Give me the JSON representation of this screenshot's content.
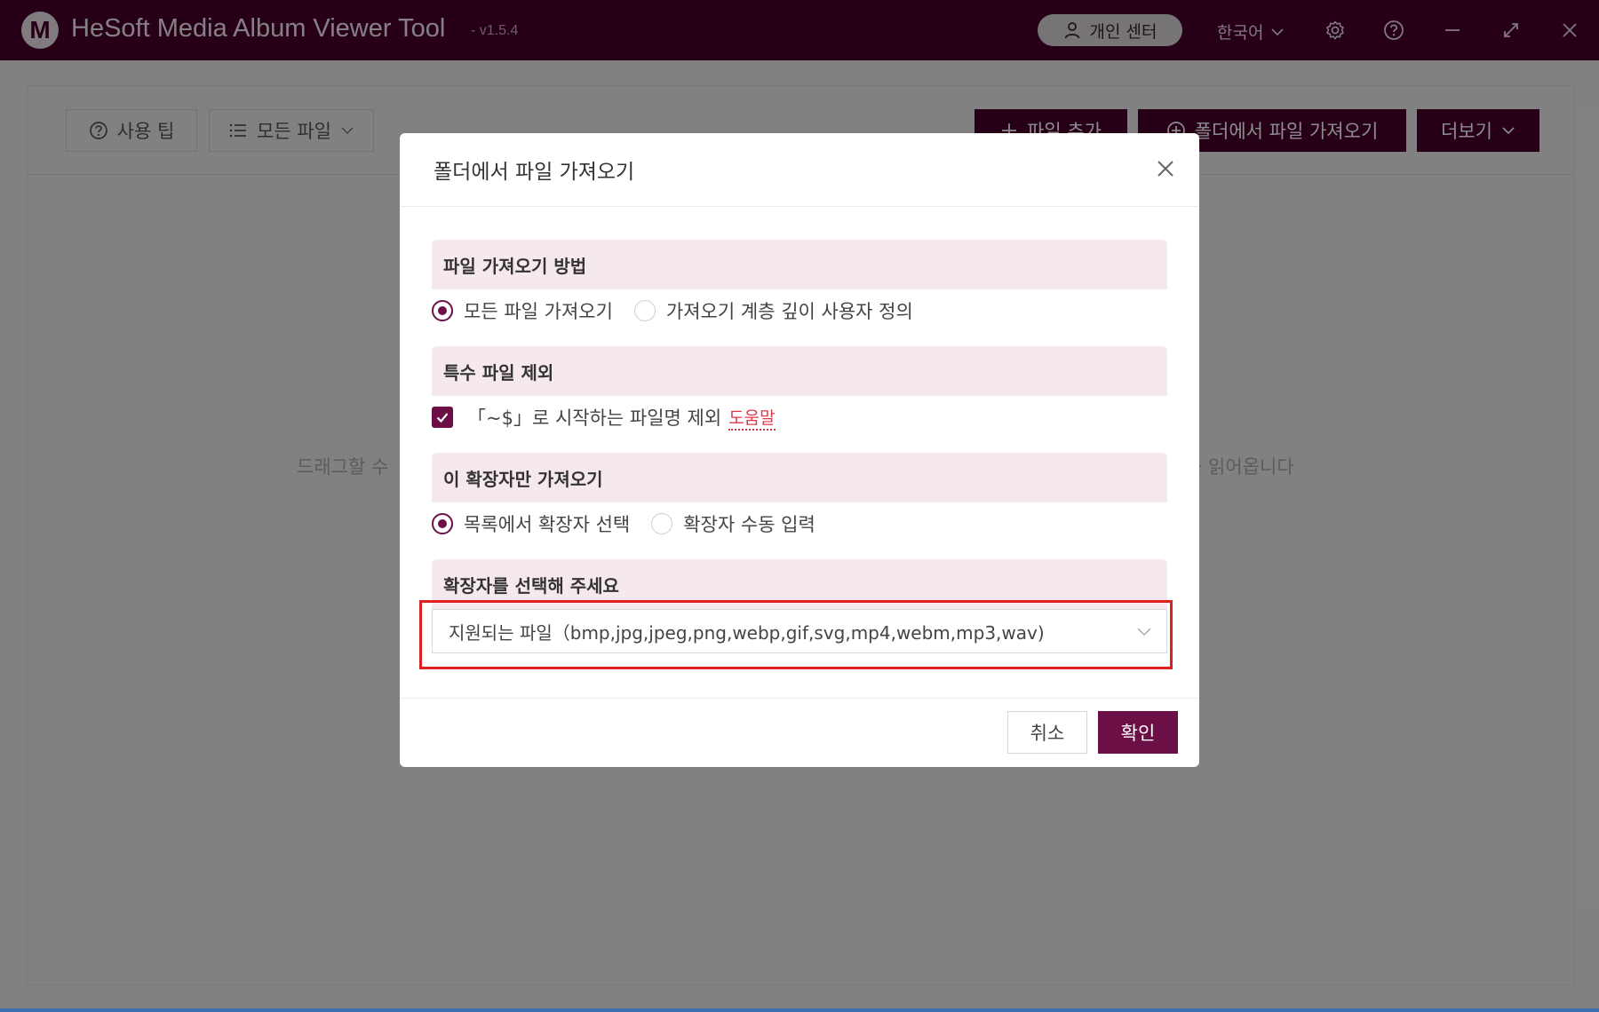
{
  "app": {
    "logo_letter": "M",
    "title": "HeSoft Media Album Viewer Tool",
    "version": "- v1.5.4",
    "user_center": "개인 센터",
    "language": "한국어"
  },
  "toolbar": {
    "tips_label": "사용 팁",
    "filter_label": "모든 파일",
    "add_file_label": "파일 추가",
    "import_folder_label": "폴더에서 파일 가져오기",
    "more_label": "더보기"
  },
  "drop_hint": {
    "left": "드래그할 수",
    "right": "를 읽어옵니다"
  },
  "dialog": {
    "title": "폴더에서 파일 가져오기",
    "section_method": "파일 가져오기 방법",
    "method_all": "모든 파일 가져오기",
    "method_custom": "가져오기 계층 깊이 사용자 정의",
    "section_exclude": "특수 파일 제외",
    "exclude_text": "「~$」로 시작하는 파일명 제외",
    "help_link": "도움말",
    "section_ext": "이 확장자만 가져오기",
    "ext_from_list": "목록에서 확장자 선택",
    "ext_manual": "확장자 수동 입력",
    "section_select": "확장자를 선택해 주세요",
    "select_value": "지원되는 파일（bmp,jpg,jpeg,png,webp,gif,svg,mp4,webm,mp3,wav)",
    "cancel": "취소",
    "ok": "확인"
  },
  "colors": {
    "brand": "#47002c",
    "accent": "#6b0f46",
    "section_bg": "#f5e8ef",
    "highlight": "#e02020",
    "link": "#e0384b"
  }
}
